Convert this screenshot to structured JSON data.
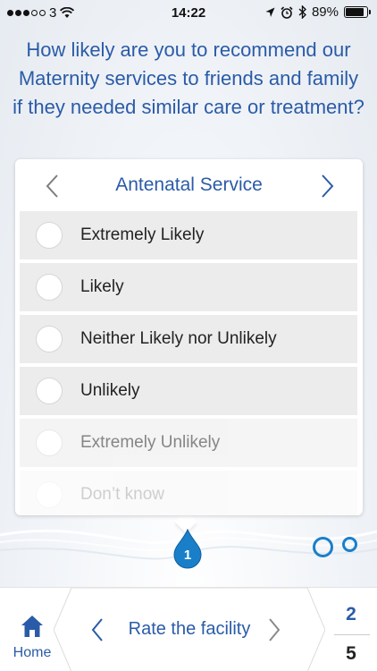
{
  "status_bar": {
    "carrier": "3",
    "time": "14:22",
    "battery_percent": "89%",
    "battery_level": 0.89,
    "icons": [
      "signal-dots",
      "wifi-icon",
      "location-arrow-icon",
      "alarm-icon",
      "bluetooth-icon",
      "battery-icon"
    ]
  },
  "question": {
    "text": "How likely are you to recommend our Maternity services to friends and family if they needed similar care or treatment?"
  },
  "card": {
    "service_title": "Antenatal Service",
    "options": [
      {
        "label": "Extremely Likely"
      },
      {
        "label": "Likely"
      },
      {
        "label": "Neither Likely nor Unlikely"
      },
      {
        "label": "Unlikely"
      },
      {
        "label": "Extremely Unlikely"
      },
      {
        "label": "Don’t know"
      }
    ]
  },
  "pager": {
    "current": "1",
    "total_dots": 3
  },
  "bottom_nav": {
    "home_label": "Home",
    "section_title": "Rate the facility",
    "next_page": "2",
    "total_pages": "5"
  },
  "colors": {
    "accent_blue": "#2a5ba8",
    "indicator_blue": "#1a7fc9",
    "option_bg": "#ececec"
  }
}
